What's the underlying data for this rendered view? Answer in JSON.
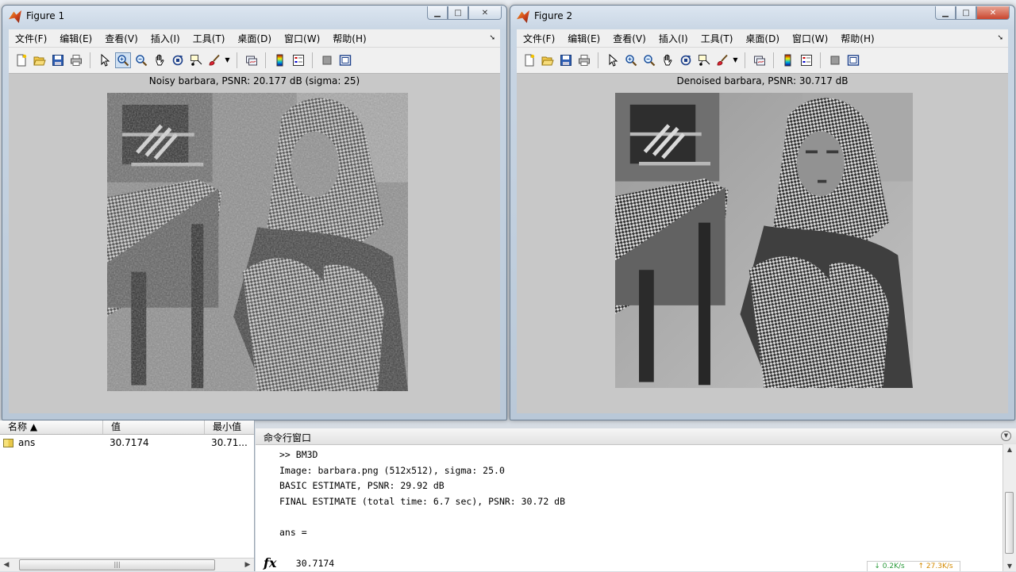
{
  "figure1": {
    "title": "Figure 1",
    "axes_title": "Noisy barbara, PSNR: 20.177 dB (sigma: 25)"
  },
  "figure2": {
    "title": "Figure 2",
    "axes_title": "Denoised barbara, PSNR: 30.717 dB"
  },
  "menu": [
    "文件(F)",
    "编辑(E)",
    "查看(V)",
    "插入(I)",
    "工具(T)",
    "桌面(D)",
    "窗口(W)",
    "帮助(H)"
  ],
  "window_buttons": {
    "minimize": "▁",
    "maximize": "□",
    "close": "✕"
  },
  "toolbar_icons": [
    "new-figure-icon",
    "open-file-icon",
    "save-icon",
    "print-icon",
    "edit-plot-arrow-icon",
    "zoom-in-icon",
    "zoom-out-icon",
    "pan-hand-icon",
    "rotate-3d-icon",
    "data-cursor-icon",
    "brush-icon",
    "link-plot-icon",
    "colorbar-icon",
    "legend-icon",
    "hide-plot-tools-icon",
    "show-plot-tools-icon"
  ],
  "workspace": {
    "columns": {
      "name": "名称 ▲",
      "value": "值",
      "min": "最小值"
    },
    "rows": [
      {
        "name": "ans",
        "value": "30.7174",
        "min": "30.71..."
      }
    ],
    "scroll_thumb": "|||"
  },
  "command_window": {
    "title": "命令行窗口",
    "lines": [
      ">> BM3D",
      "Image: barbara.png (512x512), sigma: 25.0",
      "BASIC ESTIMATE, PSNR: 29.92 dB",
      "FINAL ESTIMATE (total time: 6.7 sec), PSNR: 30.72 dB",
      "",
      "ans =",
      "",
      "   30.7174"
    ],
    "prompt_symbol": "fx"
  },
  "net_speed": {
    "down": "↓ 0.2K/s",
    "up": "↑ 27.3K/s"
  }
}
